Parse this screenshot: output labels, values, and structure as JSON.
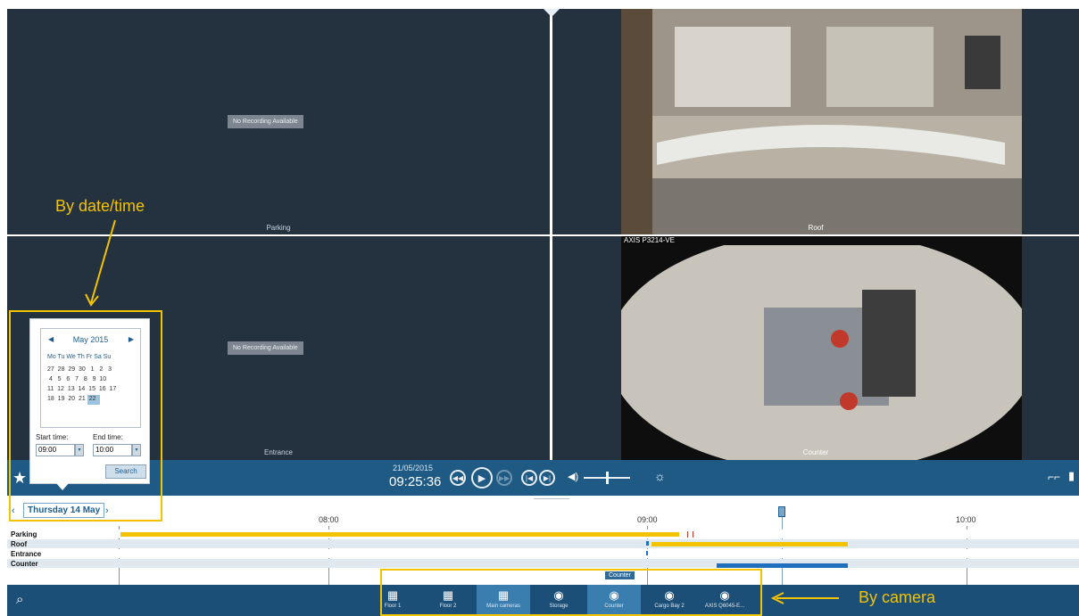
{
  "tiles": {
    "parking": {
      "label": "Parking",
      "status": "No Recording Available"
    },
    "roof": {
      "label": "Roof"
    },
    "entrance": {
      "label": "Entrance",
      "status": "No Recording Available"
    },
    "counter": {
      "label": "Counter",
      "overlay": "AXIS P3214-VE"
    }
  },
  "controls": {
    "date": "21/05/2015",
    "time": "09:25:36"
  },
  "date_nav": {
    "label": "Thursday 14 May"
  },
  "calendar": {
    "month": "May 2015",
    "weekdays": "Mo Tu We Th Fr Sa Su",
    "weeks": [
      "27  28  29  30   1   2   3",
      " 4   5   6   7   8   9  10",
      "11  12  13  14  15  16  17",
      "18  19  20  21  22"
    ],
    "selected_day": "21",
    "start_label": "Start time:",
    "end_label": "End time:",
    "start_value": "09:00",
    "end_value": "10:00",
    "search": "Search"
  },
  "timeline": {
    "ticks": [
      "08:00",
      "09:00",
      "10:00"
    ],
    "rows": [
      "Parking",
      "Roof",
      "Entrance",
      "Counter"
    ],
    "tooltip": "Counter",
    "colors": {
      "recording": "#f4c300",
      "motion": "#1f6fbf",
      "marker": "#c0392b"
    }
  },
  "views": [
    {
      "label": "Floor 1",
      "icon": "grid-icon"
    },
    {
      "label": "Floor 2",
      "icon": "grid-icon"
    },
    {
      "label": "Main cameras",
      "icon": "grid-icon"
    },
    {
      "label": "Storage",
      "icon": "camera-icon"
    },
    {
      "label": "Counter",
      "icon": "camera-icon"
    },
    {
      "label": "Cargo Bay 2",
      "icon": "camera-icon"
    },
    {
      "label": "AXIS Q6045-E...",
      "icon": "camera-icon"
    }
  ],
  "annotations": {
    "by_date": "By date/time",
    "by_camera": "By camera"
  },
  "colors": {
    "accent": "#f4c300",
    "control_bar": "#1f5a85",
    "tile_bg": "#243240"
  }
}
